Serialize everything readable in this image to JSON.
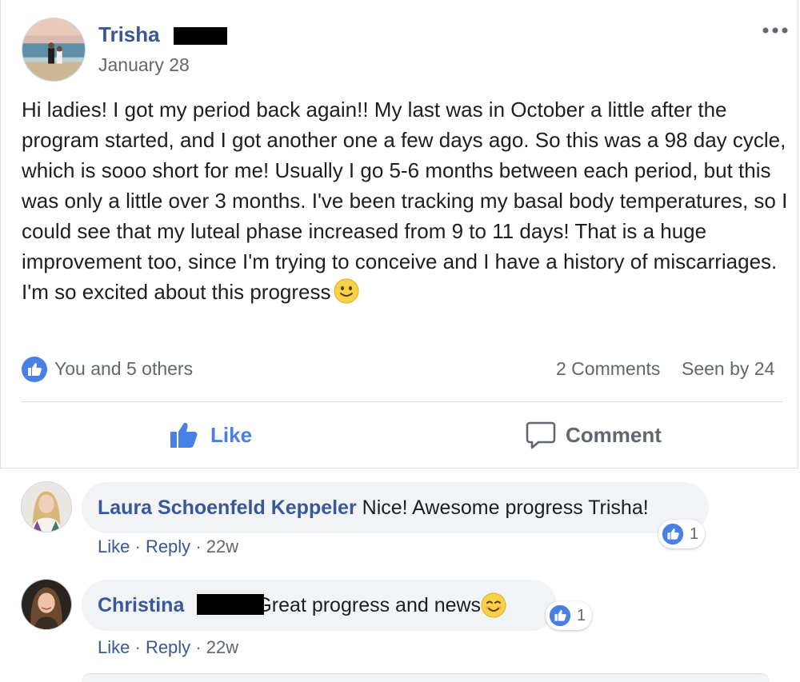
{
  "post": {
    "author": "Trisha",
    "date": "January 28",
    "body": "Hi ladies! I got my period back again!! My last was in October a little after the program started, and I got another one a few days ago. So this was a 98 day cycle, which is sooo short for me! Usually I go 5-6 months between each period, but this was only a little over 3 months. I've been tracking my basal body temperatures, so I could see that my luteal phase increased from 9 to 11 days! That is a huge improvement too, since I'm trying to conceive and I have a history of miscarriages. I'm so excited about this progress",
    "body_emoji": "slightly-smiling-face-icon",
    "reactions_summary": "You and 5 others",
    "comments_count": "2 Comments",
    "seen_by": "Seen by 24"
  },
  "actions": {
    "like": "Like",
    "comment": "Comment"
  },
  "comments": [
    {
      "author": "Laura Schoenfeld Keppeler",
      "text": "Nice! Awesome progress Trisha!",
      "likes": "1",
      "like_link": "Like",
      "reply_link": "Reply",
      "time": "22w",
      "separator": "·"
    },
    {
      "author": "Christina",
      "text": "Great progress and news",
      "likes": "1",
      "like_link": "Like",
      "reply_link": "Reply",
      "time": "22w",
      "separator": "·"
    }
  ],
  "colors": {
    "name_link": "#385898",
    "like_blue": "#4880e6",
    "meta_gray": "#606770",
    "bubble_bg": "#f2f3f5"
  }
}
